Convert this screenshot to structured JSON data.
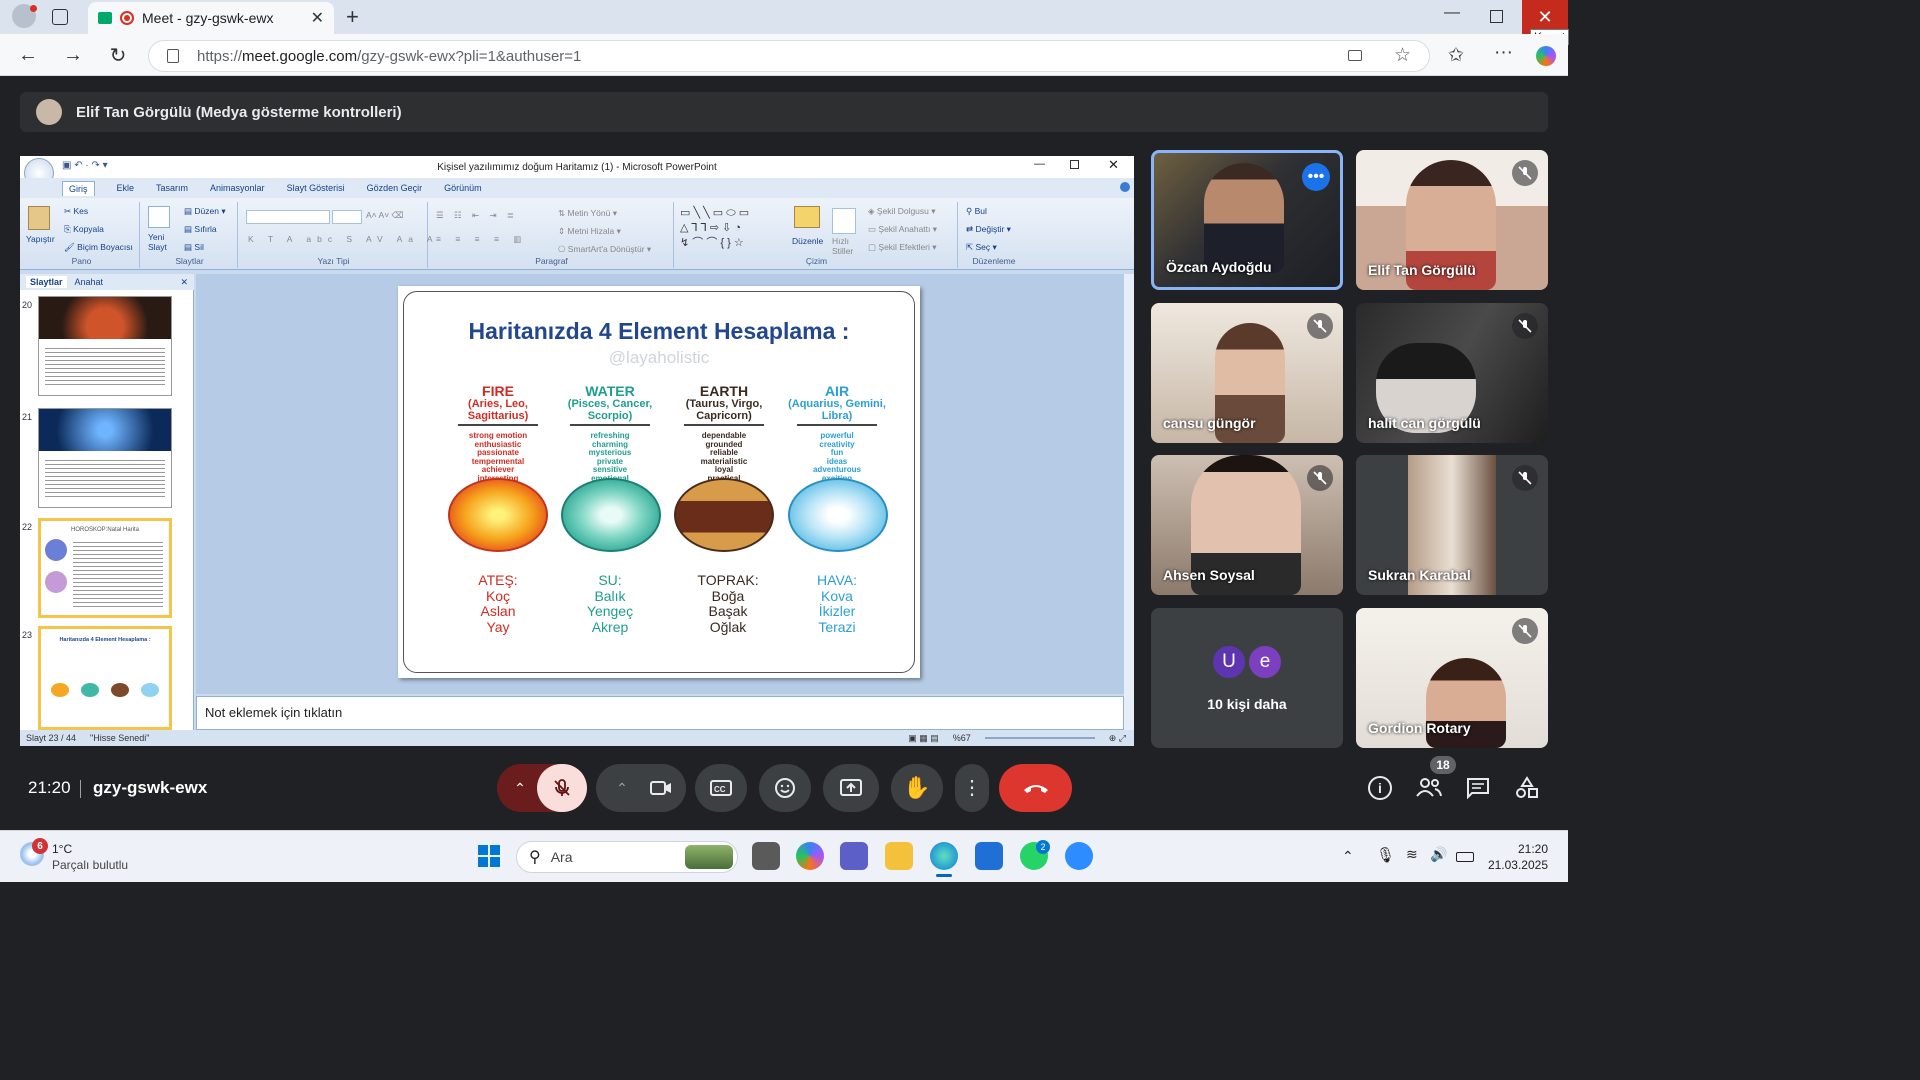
{
  "browser": {
    "tab_title": "Meet - gzy-gswk-ewx",
    "url_prefix": "https://",
    "url_host": "meet.google.com",
    "url_path": "/gzy-gswk-ewx?pli=1&authuser=1",
    "close_tooltip": "Kapat"
  },
  "meet": {
    "presenter_label": "Elif Tan Görgülü (Medya gösterme kontrolleri)",
    "time": "21:20",
    "meeting_code": "gzy-gswk-ewx",
    "participants_count": "18",
    "more_people_label": "10 kişi daha",
    "more_avatars": [
      "U",
      "e"
    ],
    "participants": [
      {
        "name": "Özcan Aydoğdu",
        "active": true
      },
      {
        "name": "Elif Tan Görgülü",
        "muted": true
      },
      {
        "name": "cansu güngör",
        "muted": true
      },
      {
        "name": "halit can görgülü",
        "muted": true
      },
      {
        "name": "Ahsen Soysal",
        "muted": true
      },
      {
        "name": "Sukran Karabal",
        "muted": true
      },
      {
        "name": "Gordion Rotary",
        "muted": true
      }
    ]
  },
  "powerpoint": {
    "window_title": "Kişisel yazılımımız doğum Haritamız (1) - Microsoft PowerPoint",
    "ribbon_tabs": [
      "Giriş",
      "Ekle",
      "Tasarım",
      "Animasyonlar",
      "Slayt Gösterisi",
      "Gözden Geçir",
      "Görünüm"
    ],
    "groups": {
      "pano": "Pano",
      "slaytlar": "Slaytlar",
      "yazi_tipi": "Yazı Tipi",
      "paragraf": "Paragraf",
      "cizim": "Çizim",
      "duzenleme": "Düzenleme"
    },
    "commands": {
      "yapistir": "Yapıştır",
      "kes": "Kes",
      "kopyala": "Kopyala",
      "bicim_boyacisi": "Biçim Boyacısı",
      "yeni_slayt": "Yeni Slayt",
      "duzen": "Düzen",
      "sifirla": "Sıfırla",
      "sil": "Sil",
      "metin_yonu": "Metin Yönü",
      "metni_hizala": "Metni Hizala",
      "smartart": "SmartArt'a Dönüştür",
      "duzenle": "Düzenle",
      "hizli_stiller": "Hızlı Stiller",
      "sekil_dolgusu": "Şekil Dolgusu",
      "sekil_anahatti": "Şekil Anahattı",
      "sekil_efektleri": "Şekil Efektleri",
      "bul": "Bul",
      "degistir": "Değiştir",
      "sec": "Seç"
    },
    "pane_tabs": [
      "Slaytlar",
      "Anahat"
    ],
    "thumb_numbers": [
      "20",
      "21",
      "22",
      "23"
    ],
    "thumb22_title": "HOROSKOP:Natal Harita",
    "thumb23_title": "Haritanızda 4 Element Hesaplama :",
    "notes_placeholder": "Not eklemek için tıklatın",
    "status_slide": "Slayt 23 / 44",
    "status_theme": "\"Hisse Senedi\"",
    "zoom": "%67"
  },
  "slide": {
    "title": "Haritanızda 4 Element Hesaplama :",
    "watermark": "@layaholistic",
    "elements": [
      {
        "name": "FIRE",
        "signs": "(Aries, Leo, Sagittarius)",
        "traits": [
          "strong emotion",
          "enthusiastic",
          "passionate",
          "tempermental",
          "achiever",
          "interesting"
        ],
        "tr_name": "ATEŞ:",
        "tr_signs": [
          "Koç",
          "Aslan",
          "Yay"
        ],
        "color": "#d22b22"
      },
      {
        "name": "WATER",
        "signs": "(Pisces, Cancer, Scorpio)",
        "traits": [
          "refreshing",
          "charming",
          "mysterious",
          "private",
          "sensitive",
          "emotional"
        ],
        "tr_name": "SU:",
        "tr_signs": [
          "Balık",
          "Yengeç",
          "Akrep"
        ],
        "color": "#1e9e8f"
      },
      {
        "name": "EARTH",
        "signs": "(Taurus, Virgo, Capricorn)",
        "traits": [
          "dependable",
          "grounded",
          "reliable",
          "materialistic",
          "loyal",
          "practical"
        ],
        "tr_name": "TOPRAK:",
        "tr_signs": [
          "Boğa",
          "Başak",
          "Oğlak"
        ],
        "color": "#3b2a20"
      },
      {
        "name": "AIR",
        "signs": "(Aquarius, Gemini, Libra)",
        "traits": [
          "powerful",
          "creativity",
          "fun",
          "ideas",
          "adventurous",
          "exciting"
        ],
        "tr_name": "HAVA:",
        "tr_signs": [
          "Kova",
          "İkizler",
          "Terazi"
        ],
        "color": "#2a9fd6"
      }
    ]
  },
  "taskbar": {
    "weather_temp": "1°C",
    "weather_desc": "Parçalı bulutlu",
    "weather_badge": "6",
    "search_label": "Ara",
    "whatsapp_badge": "2",
    "time": "21:20",
    "date": "21.03.2025"
  }
}
